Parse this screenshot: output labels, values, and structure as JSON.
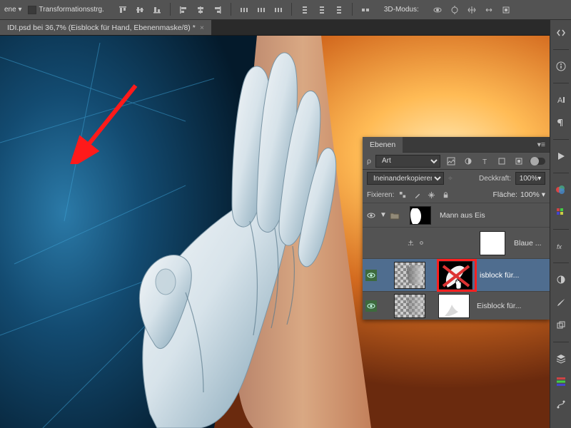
{
  "toolbar": {
    "dropdown_label": "ene",
    "checkbox_label": "Transformationsstrg.",
    "mode_label": "3D-Modus:"
  },
  "tab": {
    "title": "IDI.psd bei 36,7% (Eisblock für Hand, Ebenenmaske/8) *"
  },
  "layers_panel": {
    "tab_label": "Ebenen",
    "filter_kind_label": "Art",
    "blend_mode": "Ineinanderkopieren",
    "opacity_label": "Deckkraft:",
    "opacity_value": "100%",
    "lock_label": "Fixieren:",
    "fill_label": "Fläche:",
    "fill_value": "100%",
    "layers": {
      "group_name": "Mann aus Eis",
      "adjustment_name": "Blaue ...",
      "layer1_name": "isblock für...",
      "layer2_name": "Eisblock für..."
    }
  }
}
